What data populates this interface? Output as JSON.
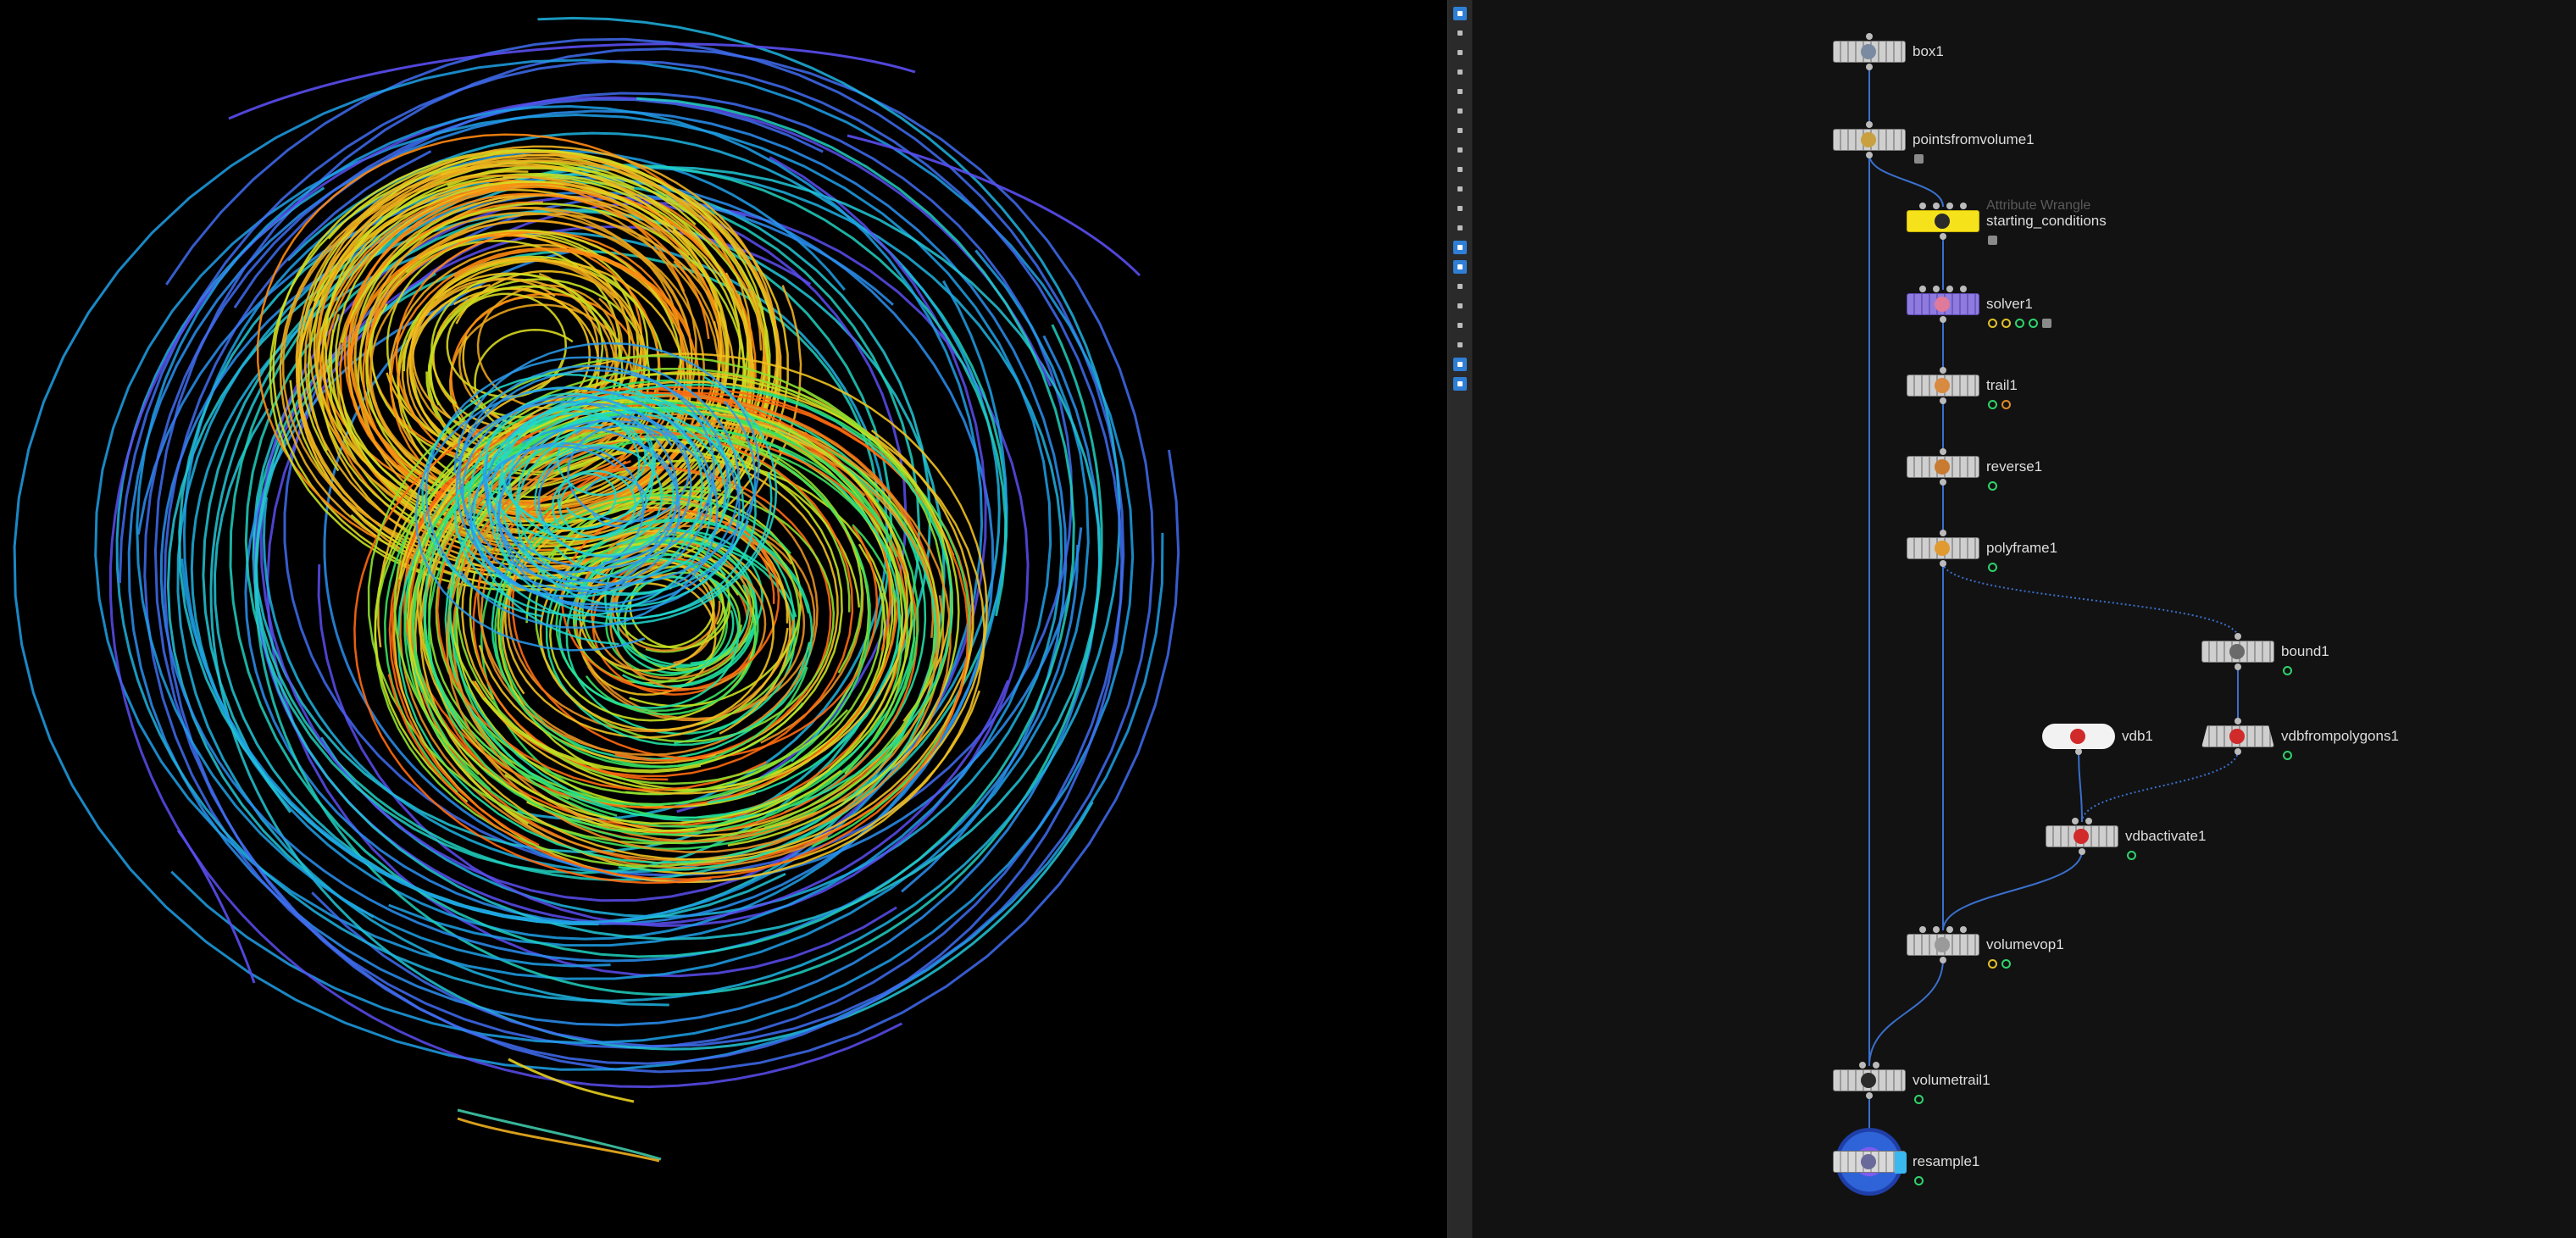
{
  "network": {
    "nodes": [
      {
        "key": "box1",
        "label": "box1",
        "type_label": "",
        "icon": "box-icon",
        "style": "standard",
        "inputs": 1,
        "flags": []
      },
      {
        "key": "pointsfromvolume1",
        "label": "pointsfromvolume1",
        "type_label": "",
        "icon": "points-from-volume-icon",
        "style": "standard",
        "inputs": 1,
        "flags": [
          "lock"
        ]
      },
      {
        "key": "starting_conditions",
        "label": "starting_conditions",
        "type_label": "Attribute Wrangle",
        "icon": "wrangle-icon",
        "style": "yellow",
        "inputs": 4,
        "flags": [
          "lock"
        ]
      },
      {
        "key": "solver1",
        "label": "solver1",
        "type_label": "",
        "icon": "solver-icon",
        "style": "purple",
        "inputs": 4,
        "flags": [
          "cook",
          "bypass",
          "display",
          "template",
          "lock"
        ]
      },
      {
        "key": "trail1",
        "label": "trail1",
        "type_label": "",
        "icon": "trail-icon",
        "style": "standard",
        "inputs": 1,
        "flags": [
          "display",
          "warning"
        ]
      },
      {
        "key": "reverse1",
        "label": "reverse1",
        "type_label": "",
        "icon": "reverse-icon",
        "style": "standard",
        "inputs": 1,
        "flags": [
          "display"
        ]
      },
      {
        "key": "polyframe1",
        "label": "polyframe1",
        "type_label": "",
        "icon": "polyframe-icon",
        "style": "standard",
        "inputs": 1,
        "flags": [
          "display"
        ]
      },
      {
        "key": "bound1",
        "label": "bound1",
        "type_label": "",
        "icon": "bound-icon",
        "style": "standard",
        "inputs": 1,
        "flags": [
          "display"
        ]
      },
      {
        "key": "vdb1",
        "label": "vdb1",
        "type_label": "",
        "icon": "vdb-icon",
        "style": "cloud",
        "inputs": 0,
        "flags": []
      },
      {
        "key": "vdbfrompolygons1",
        "label": "vdbfrompolygons1",
        "type_label": "",
        "icon": "vdb-from-polygons-icon",
        "style": "trapezoid",
        "inputs": 1,
        "flags": [
          "display"
        ]
      },
      {
        "key": "vdbactivate1",
        "label": "vdbactivate1",
        "type_label": "",
        "icon": "vdb-activate-icon",
        "style": "standard",
        "inputs": 2,
        "flags": [
          "display"
        ]
      },
      {
        "key": "volumevop1",
        "label": "volumevop1",
        "type_label": "",
        "icon": "volume-vop-icon",
        "style": "standard",
        "inputs": 4,
        "flags": [
          "bypass",
          "display"
        ]
      },
      {
        "key": "volumetrail1",
        "label": "volumetrail1",
        "type_label": "",
        "icon": "volume-trail-icon",
        "style": "standard",
        "inputs": 2,
        "flags": [
          "display"
        ]
      },
      {
        "key": "resample1",
        "label": "resample1",
        "type_label": "",
        "icon": "resample-icon",
        "style": "display",
        "inputs": 1,
        "flags": [
          "display"
        ]
      }
    ]
  },
  "colors": {
    "network_bg": "#121212",
    "wire": "#3a6fcc",
    "node_yellow": "#f5e21b",
    "node_purple": "#8f7be0",
    "display_ring": "#2f63d8",
    "flag_green": "#2fd36b",
    "toolbar_active": "#2f7fd6",
    "viewport_bg": "#000000"
  },
  "toolbar": {
    "buttons": [
      {
        "name": "select-tool-icon",
        "active": true
      },
      {
        "name": "transform-tool-icon",
        "active": false
      },
      {
        "name": "handle-tool-icon",
        "active": false
      },
      {
        "name": "view-tool-icon",
        "active": false
      },
      {
        "name": "point-snap-icon",
        "active": false
      },
      {
        "name": "edge-snap-icon",
        "active": false
      },
      {
        "name": "primitive-snap-icon",
        "active": false
      },
      {
        "name": "brush-icon",
        "active": false
      },
      {
        "name": "display-options-icon",
        "active": false
      },
      {
        "name": "camera-icon",
        "active": false
      },
      {
        "name": "lights-icon",
        "active": false
      },
      {
        "name": "frame-icon",
        "active": false
      },
      {
        "name": "wireframe-toggle-icon",
        "active": true
      },
      {
        "name": "shaded-toggle-icon",
        "active": true
      },
      {
        "name": "ghost-icon",
        "active": false
      },
      {
        "name": "background-icon",
        "active": false
      },
      {
        "name": "normals-icon",
        "active": false
      },
      {
        "name": "stop-icon",
        "active": false
      },
      {
        "name": "snapshot-icon",
        "active": true
      },
      {
        "name": "info-icon",
        "active": true
      }
    ]
  }
}
